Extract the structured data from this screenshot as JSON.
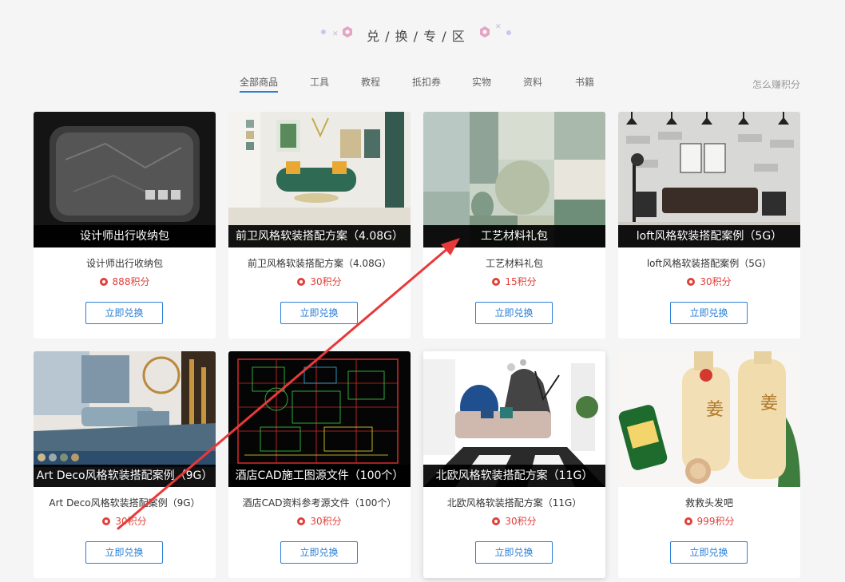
{
  "header": {
    "title": "兑 / 换 / 专 / 区"
  },
  "tabs": [
    {
      "label": "全部商品",
      "active": true
    },
    {
      "label": "工具",
      "active": false
    },
    {
      "label": "教程",
      "active": false
    },
    {
      "label": "抵扣券",
      "active": false
    },
    {
      "label": "实物",
      "active": false
    },
    {
      "label": "资料",
      "active": false
    },
    {
      "label": "书籍",
      "active": false
    }
  ],
  "earn_points_link": "怎么赚积分",
  "products": [
    {
      "overlay": "设计师出行收纳包",
      "name": "设计师出行收纳包",
      "points": "888积分",
      "button": "立即兑换"
    },
    {
      "overlay": "前卫风格软装搭配方案（4.08G）",
      "name": "前卫风格软装搭配方案（4.08G）",
      "points": "30积分",
      "button": "立即兑换"
    },
    {
      "overlay": "工艺材料礼包",
      "name": "工艺材料礼包",
      "points": "15积分",
      "button": "立即兑换"
    },
    {
      "overlay": "loft风格软装搭配案例（5G）",
      "name": "loft风格软装搭配案例（5G）",
      "points": "30积分",
      "button": "立即兑换"
    },
    {
      "overlay": "Art Deco风格软装搭配案例（9G）",
      "name": "Art Deco风格软装搭配案例（9G）",
      "points": "30积分",
      "button": "立即兑换"
    },
    {
      "overlay": "酒店CAD施工图源文件（100个）",
      "name": "酒店CAD资料参考源文件（100个）",
      "points": "30积分",
      "button": "立即兑换"
    },
    {
      "overlay": "北欧风格软装搭配方案（11G）",
      "name": "北欧风格软装搭配方案（11G）",
      "points": "30积分",
      "button": "立即兑换"
    },
    {
      "overlay": "",
      "name": "救救头发吧",
      "points": "999积分",
      "button": "立即兑换"
    }
  ],
  "colors": {
    "accent_blue": "#2b7fd6",
    "points_red": "#e0403a",
    "annotation_arrow": "#e8393a"
  }
}
